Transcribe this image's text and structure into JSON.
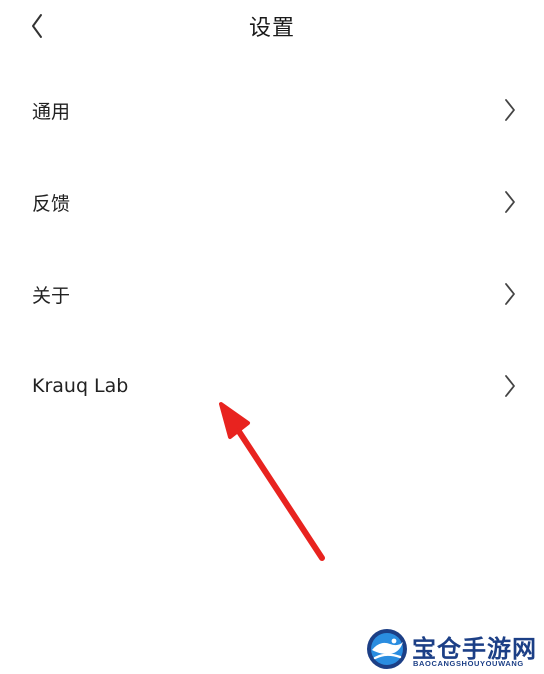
{
  "header": {
    "title": "设置",
    "back_icon": "chevron-left-icon"
  },
  "menu": {
    "items": [
      {
        "label": "通用",
        "icon": "chevron-right-icon"
      },
      {
        "label": "反馈",
        "icon": "chevron-right-icon"
      },
      {
        "label": "关于",
        "icon": "chevron-right-icon"
      },
      {
        "label": "Krauq Lab",
        "icon": "chevron-right-icon"
      }
    ]
  },
  "annotation": {
    "color": "#e8231f"
  },
  "watermark": {
    "title": "宝仓手游网",
    "subtitle": "BAOCANGSHOUYOUWANG",
    "color": "#1c3f86"
  }
}
